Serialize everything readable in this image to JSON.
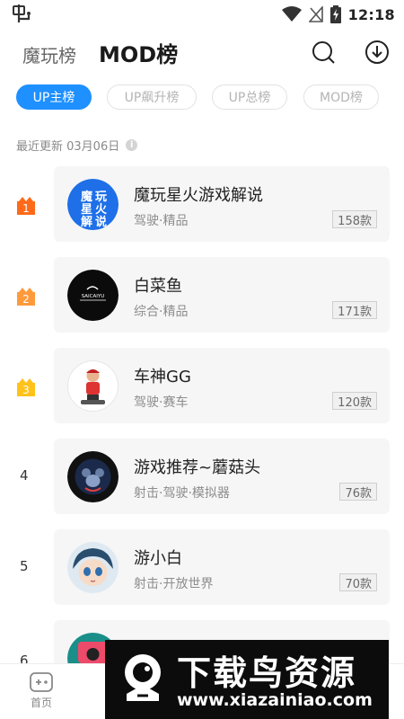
{
  "status_bar": {
    "time": "12:18"
  },
  "header": {
    "tab_inactive": "魔玩榜",
    "tab_active": "MOD榜"
  },
  "chips": [
    "UP主榜",
    "UP飙升榜",
    "UP总榜",
    "MOD榜"
  ],
  "updated": "最近更新 03月06日",
  "rows": [
    {
      "rank": "1",
      "name": "魔玩星火游戏解说",
      "tags": "驾驶·精品",
      "count": "158款",
      "avatar_text": [
        "魔",
        "玩",
        "星",
        "火",
        "解",
        "说"
      ]
    },
    {
      "rank": "2",
      "name": "白菜鱼",
      "tags": "综合·精品",
      "count": "171款",
      "avatar_text": "SAICAIYU"
    },
    {
      "rank": "3",
      "name": "车神GG",
      "tags": "驾驶·赛车",
      "count": "120款"
    },
    {
      "rank": "4",
      "name": "游戏推荐~蘑菇头",
      "tags": "射击·驾驶·模拟器",
      "count": "76款"
    },
    {
      "rank": "5",
      "name": "游小白",
      "tags": "射击·开放世界",
      "count": "70款"
    },
    {
      "rank": "6"
    }
  ],
  "bottom_nav": {
    "home": "首页"
  },
  "watermark": {
    "title": "下载鸟资源",
    "url": "www.xiazainiao.com"
  },
  "colors": {
    "accent": "#1e90ff",
    "rank1": "#ff6a1a",
    "rank2": "#ff9a3c",
    "rank3": "#ffc21a"
  }
}
